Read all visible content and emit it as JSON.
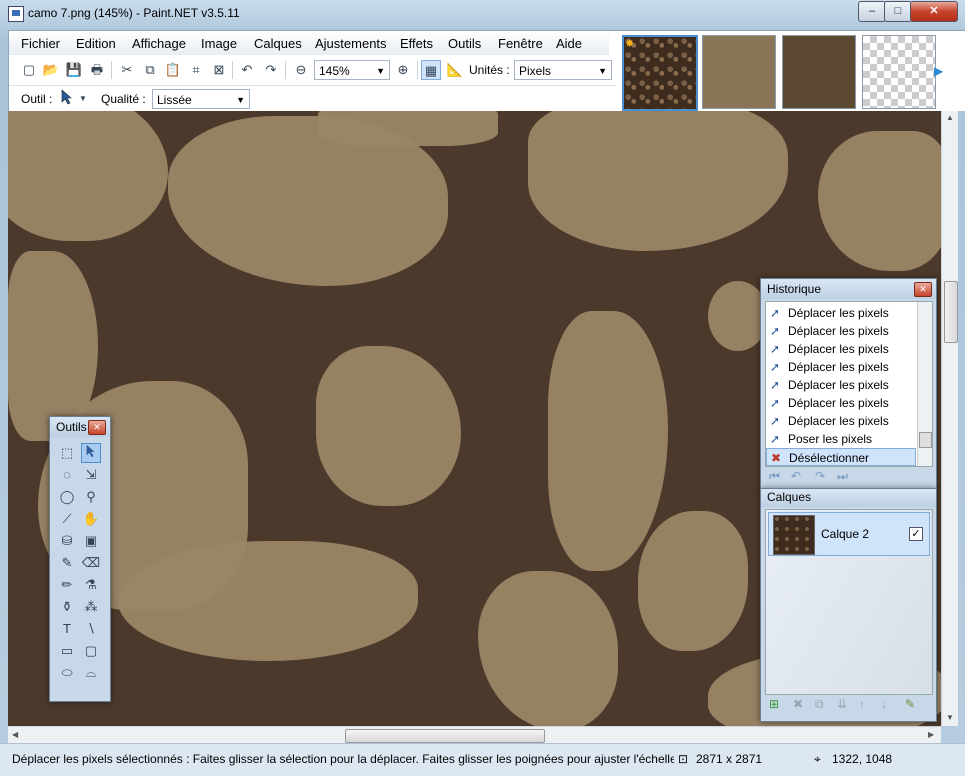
{
  "window": {
    "title": "camo 7.png (145%) - Paint.NET v3.5.11",
    "minimize": "–",
    "maximize": "□",
    "close": "✕"
  },
  "menu": [
    "Fichier",
    "Edition",
    "Affichage",
    "Image",
    "Calques",
    "Ajustements",
    "Effets",
    "Outils",
    "Fenêtre",
    "Aide"
  ],
  "toolbar": {
    "zoom_value": "145%",
    "units_label": "Unités :",
    "units_value": "Pixels",
    "tool_label": "Outil :",
    "quality_label": "Qualité :",
    "quality_value": "Lissée"
  },
  "icons": {
    "new": "▢",
    "open": "📂",
    "save": "💾",
    "print": "🖶",
    "cut": "✂",
    "copy": "⧉",
    "paste": "📋",
    "crop": "⌗",
    "deselect": "⊠",
    "undo": "↶",
    "redo": "↷",
    "zoom_out": "⊖",
    "zoom_in": "⊕",
    "grid": "▦",
    "rulers": "📐",
    "dropdown": "▼",
    "thumb_star": "✸",
    "next": "▶"
  },
  "tools_window": {
    "title": "Outils",
    "close": "✕"
  },
  "history": {
    "title": "Historique",
    "close": "✕",
    "items": [
      {
        "label": "Déplacer les pixels"
      },
      {
        "label": "Déplacer les pixels"
      },
      {
        "label": "Déplacer les pixels"
      },
      {
        "label": "Déplacer les pixels"
      },
      {
        "label": "Déplacer les pixels"
      },
      {
        "label": "Déplacer les pixels"
      },
      {
        "label": "Déplacer les pixels"
      },
      {
        "label": "Poser les pixels"
      },
      {
        "label": "Désélectionner"
      }
    ],
    "controls": [
      "⏮",
      "↶",
      "↷",
      "⏭"
    ]
  },
  "layers": {
    "title": "Calques",
    "items": [
      {
        "name": "Calque 2",
        "visible": true
      }
    ],
    "check": "✓",
    "controls": [
      "⊞",
      "✖",
      "⧉",
      "⇊",
      "↑",
      "↓",
      "✎"
    ]
  },
  "status": {
    "hint": "Déplacer les pixels sélectionnés : Faites glisser la sélection pour la déplacer. Faites glisser les poignées pour ajuster l'échelle. Fai",
    "image_size": "2871 x 2871",
    "cursor_pos": "1322, 1048"
  },
  "colors": {
    "canvas_dark": "#4b3a2c",
    "canvas_light": "#9a8566",
    "accent": "#4b8fd0"
  }
}
